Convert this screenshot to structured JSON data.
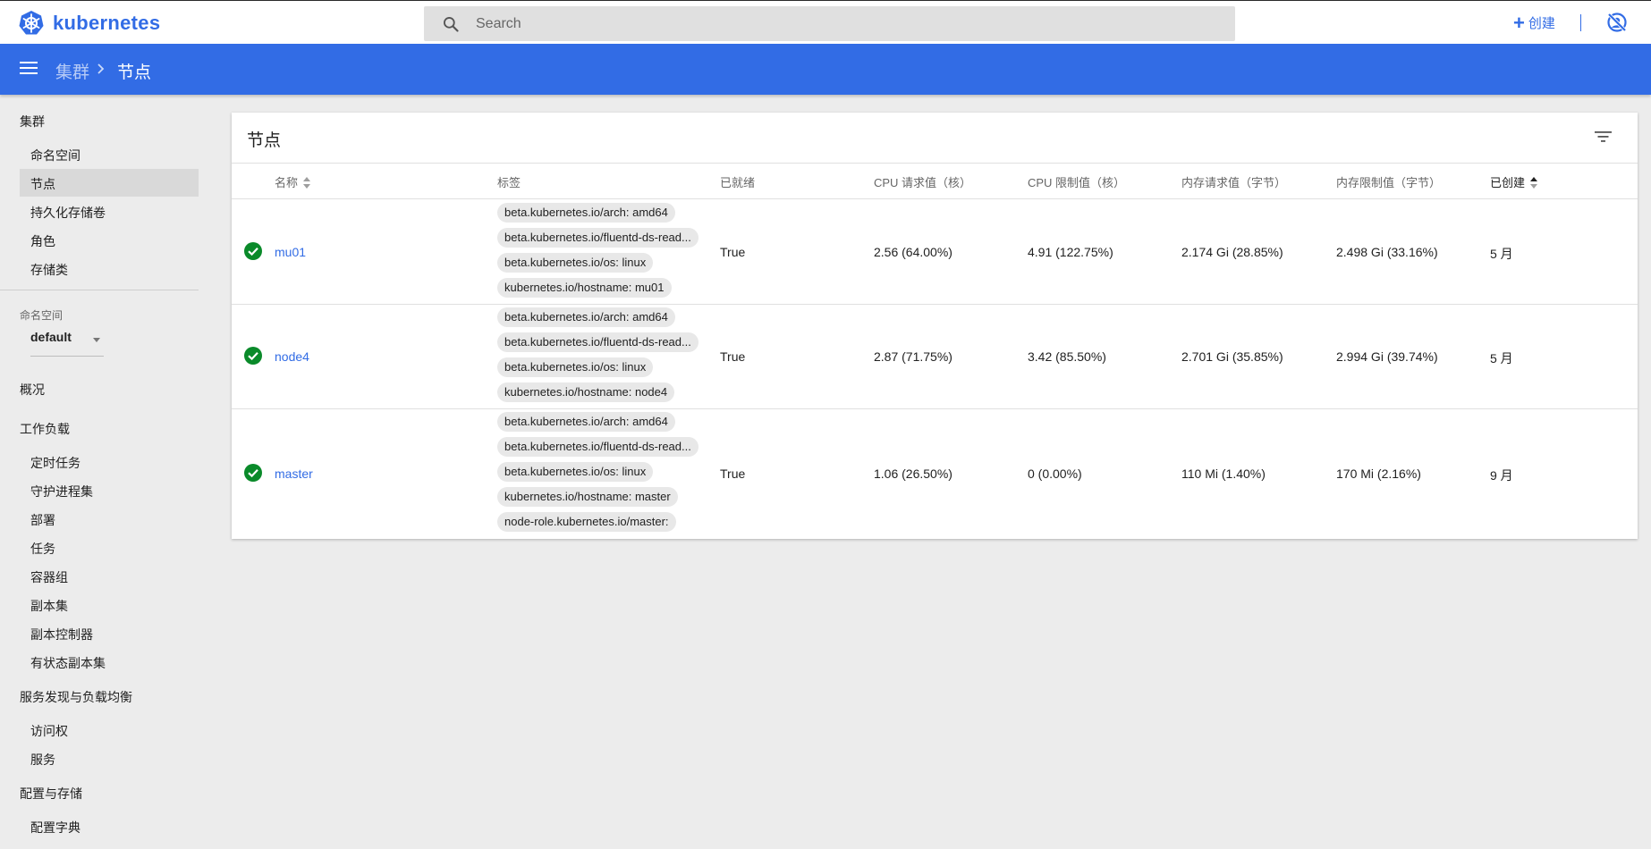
{
  "header": {
    "brand": "kubernetes",
    "search_placeholder": "Search",
    "create_label": "创建"
  },
  "breadcrumb": {
    "cluster": "集群",
    "current": "节点"
  },
  "sidebar": {
    "cluster_header": "集群",
    "cluster_items": [
      {
        "label": "命名空间"
      },
      {
        "label": "节点",
        "active": true
      },
      {
        "label": "持久化存储卷"
      },
      {
        "label": "角色"
      },
      {
        "label": "存储类"
      }
    ],
    "namespace_label": "命名空间",
    "namespace_value": "default",
    "overview": "概况",
    "workloads_header": "工作负载",
    "workloads_items": [
      "定时任务",
      "守护进程集",
      "部署",
      "任务",
      "容器组",
      "副本集",
      "副本控制器",
      "有状态副本集"
    ],
    "discovery_header": "服务发现与负载均衡",
    "discovery_items": [
      "访问权",
      "服务"
    ],
    "config_header": "配置与存储",
    "config_items": [
      "配置字典"
    ]
  },
  "card": {
    "title": "节点",
    "columns": [
      "名称",
      "标签",
      "已就绪",
      "CPU 请求值（核）",
      "CPU 限制值（核）",
      "内存请求值（字节）",
      "内存限制值（字节）",
      "已创建"
    ],
    "rows": [
      {
        "name": "mu01",
        "labels": [
          "beta.kubernetes.io/arch: amd64",
          "beta.kubernetes.io/fluentd-ds-read...",
          "beta.kubernetes.io/os: linux",
          "kubernetes.io/hostname: mu01"
        ],
        "ready": "True",
        "cpu_req": "2.56 (64.00%)",
        "cpu_lim": "4.91 (122.75%)",
        "mem_req": "2.174 Gi (28.85%)",
        "mem_lim": "2.498 Gi (33.16%)",
        "created": "5 月"
      },
      {
        "name": "node4",
        "labels": [
          "beta.kubernetes.io/arch: amd64",
          "beta.kubernetes.io/fluentd-ds-read...",
          "beta.kubernetes.io/os: linux",
          "kubernetes.io/hostname: node4"
        ],
        "ready": "True",
        "cpu_req": "2.87 (71.75%)",
        "cpu_lim": "3.42 (85.50%)",
        "mem_req": "2.701 Gi (35.85%)",
        "mem_lim": "2.994 Gi (39.74%)",
        "created": "5 月"
      },
      {
        "name": "master",
        "labels": [
          "beta.kubernetes.io/arch: amd64",
          "beta.kubernetes.io/fluentd-ds-read...",
          "beta.kubernetes.io/os: linux",
          "kubernetes.io/hostname: master",
          "node-role.kubernetes.io/master:"
        ],
        "ready": "True",
        "cpu_req": "1.06 (26.50%)",
        "cpu_lim": "0 (0.00%)",
        "mem_req": "110 Mi (1.40%)",
        "mem_lim": "170 Mi (2.16%)",
        "created": "9 月"
      }
    ]
  },
  "colors": {
    "brand_blue": "#326ce5",
    "ready_green": "#0a8a2a",
    "page_bg": "#ececec"
  }
}
